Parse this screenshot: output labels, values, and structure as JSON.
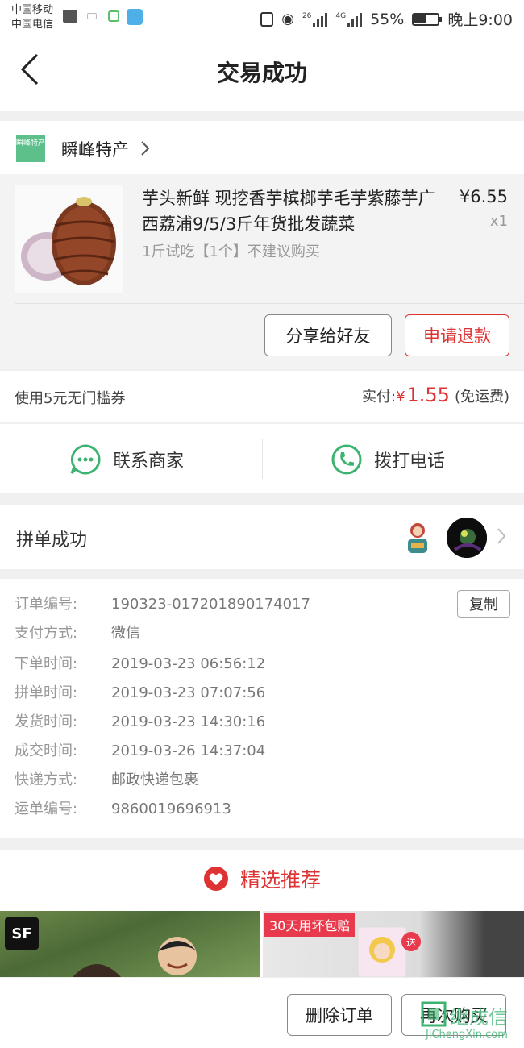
{
  "status": {
    "carrier1": "中国移动",
    "carrier2": "中国电信",
    "net1": "26",
    "net2": "4G",
    "battery": "55%",
    "battery_level": 0.55,
    "time": "晚上9:00"
  },
  "header": {
    "title": "交易成功"
  },
  "shop": {
    "logo_text": "瞬峰特产",
    "name": "瞬峰特产"
  },
  "product": {
    "title": "芋头新鲜 现挖香芋槟榔芋毛芋紫藤芋广西荔浦9/5/3斤年货批发蔬菜",
    "spec": "1斤试吃【1个】不建议购买",
    "price": "¥6.55",
    "qty": "x1",
    "share_label": "分享给好友",
    "refund_label": "申请退款"
  },
  "payment": {
    "coupon": "使用5元无门槛券",
    "paid_label": "实付:",
    "currency": "¥",
    "amount": "1.55",
    "shipping": "(免运费)"
  },
  "contact": {
    "merchant": "联系商家",
    "call": "拨打电话"
  },
  "group": {
    "label": "拼单成功"
  },
  "order": {
    "copy_label": "复制",
    "rows": [
      {
        "k": "订单编号:",
        "v": "190323-017201890174017"
      },
      {
        "k": "支付方式:",
        "v": "微信"
      },
      {
        "k": "下单时间:",
        "v": "2019-03-23 06:56:12"
      },
      {
        "k": "拼单时间:",
        "v": "2019-03-23 07:07:56"
      },
      {
        "k": "发货时间:",
        "v": "2019-03-23 14:30:16"
      },
      {
        "k": "成交时间:",
        "v": "2019-03-26 14:37:04"
      },
      {
        "k": "快递方式:",
        "v": "邮政快递包裹"
      },
      {
        "k": "运单编号:",
        "v": "9860019696913"
      }
    ]
  },
  "recommend": {
    "title": "精选推荐",
    "item1_badge": "SF",
    "item2_badge": "30天用坏包赔",
    "item2_send": "送"
  },
  "bottom": {
    "delete_label": "删除订单",
    "rebuy_label": "再次购买"
  },
  "watermark": {
    "brand": "继成信",
    "url": "JiChengXin.com"
  },
  "colors": {
    "accent": "#dd3333",
    "green": "#3cb371",
    "muted": "#999999"
  }
}
